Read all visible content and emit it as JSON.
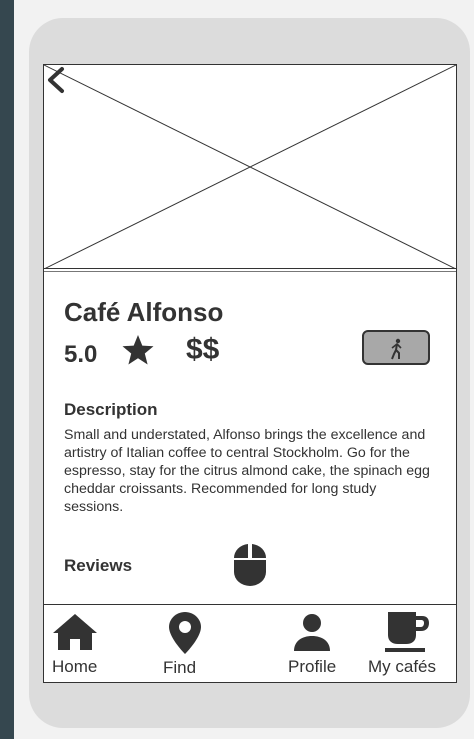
{
  "cafe": {
    "name": "Café Alfonso",
    "rating": "5.0",
    "price": "$$"
  },
  "description": {
    "title": "Description",
    "text": "Small and understated, Alfonso brings the excellence and artistry of Italian coffee to central Stockholm. Go for the espresso, stay for the citrus almond cake, the spinach egg cheddar croissants. Recommended for long study sessions."
  },
  "reviews": {
    "title": "Reviews"
  },
  "tabs": [
    {
      "label": "Home",
      "icon": "home-icon"
    },
    {
      "label": "Find",
      "icon": "map-pin-icon"
    },
    {
      "label": "Profile",
      "icon": "person-icon"
    },
    {
      "label": "My cafés",
      "icon": "coffee-cup-icon"
    }
  ],
  "icons": {
    "back": "chevron-left-icon",
    "star": "star-icon",
    "walk": "walking-person-icon",
    "scroll": "mouse-icon"
  },
  "colors": {
    "text": "#333333",
    "button_fill": "#a8a8a8",
    "phone_frame": "#dcdcdc",
    "background": "#35474f"
  }
}
